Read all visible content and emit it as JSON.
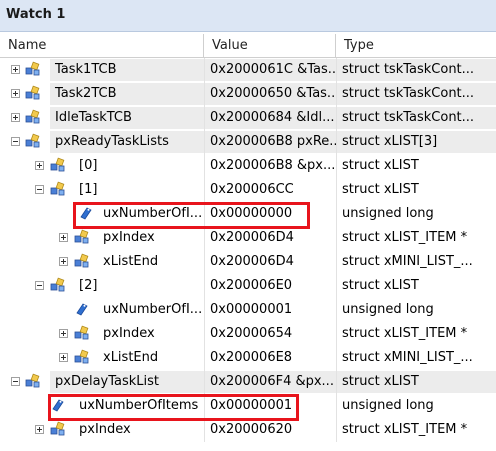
{
  "window": {
    "title": "Watch 1"
  },
  "columns": {
    "name": "Name",
    "value": "Value",
    "type": "Type"
  },
  "rows": [
    {
      "name": "Task1TCB",
      "value": "0x2000061C &Tas...",
      "type": "struct tskTaskCont...",
      "expander": "plus",
      "icon": "struct-icon"
    },
    {
      "name": "Task2TCB",
      "value": "0x20000650 &Tas...",
      "type": "struct tskTaskCont...",
      "expander": "plus",
      "icon": "struct-icon"
    },
    {
      "name": "IdleTaskTCB",
      "value": "0x20000684 &Idl...",
      "type": "struct tskTaskCont...",
      "expander": "plus",
      "icon": "struct-icon"
    },
    {
      "name": "pxReadyTaskLists",
      "value": "0x200006B8 pxRe...",
      "type": "struct xLIST[3]",
      "expander": "minus",
      "icon": "struct-icon"
    },
    {
      "name": "[0]",
      "value": "0x200006B8 &px...",
      "type": "struct xLIST",
      "expander": "plus",
      "icon": "struct-icon"
    },
    {
      "name": "[1]",
      "value": "0x200006CC",
      "type": "struct xLIST",
      "expander": "minus",
      "icon": "struct-icon"
    },
    {
      "name": "uxNumberOfI...",
      "value": "0x00000000",
      "type": "unsigned long",
      "expander": "none",
      "icon": "variable-icon"
    },
    {
      "name": "pxIndex",
      "value": "0x200006D4",
      "type": "struct xLIST_ITEM *",
      "expander": "plus",
      "icon": "struct-icon"
    },
    {
      "name": "xListEnd",
      "value": "0x200006D4",
      "type": "struct xMINI_LIST_...",
      "expander": "plus",
      "icon": "struct-icon"
    },
    {
      "name": "[2]",
      "value": "0x200006E0",
      "type": "struct xLIST",
      "expander": "minus",
      "icon": "struct-icon"
    },
    {
      "name": "uxNumberOfI...",
      "value": "0x00000001",
      "type": "unsigned long",
      "expander": "none",
      "icon": "variable-icon"
    },
    {
      "name": "pxIndex",
      "value": "0x20000654",
      "type": "struct xLIST_ITEM *",
      "expander": "plus",
      "icon": "struct-icon"
    },
    {
      "name": "xListEnd",
      "value": "0x200006E8",
      "type": "struct xMINI_LIST_...",
      "expander": "plus",
      "icon": "struct-icon"
    },
    {
      "name": "pxDelayTaskList",
      "value": "0x200006F4 &px...",
      "type": "struct xLIST",
      "expander": "minus",
      "icon": "struct-icon"
    },
    {
      "name": "uxNumberOfItems",
      "value": "0x00000001",
      "type": "unsigned long",
      "expander": "none",
      "icon": "variable-icon"
    },
    {
      "name": "pxIndex",
      "value": "0x20000620",
      "type": "struct xLIST_ITEM *",
      "expander": "plus",
      "icon": "struct-icon"
    }
  ],
  "highlight_color": "#e8141c"
}
